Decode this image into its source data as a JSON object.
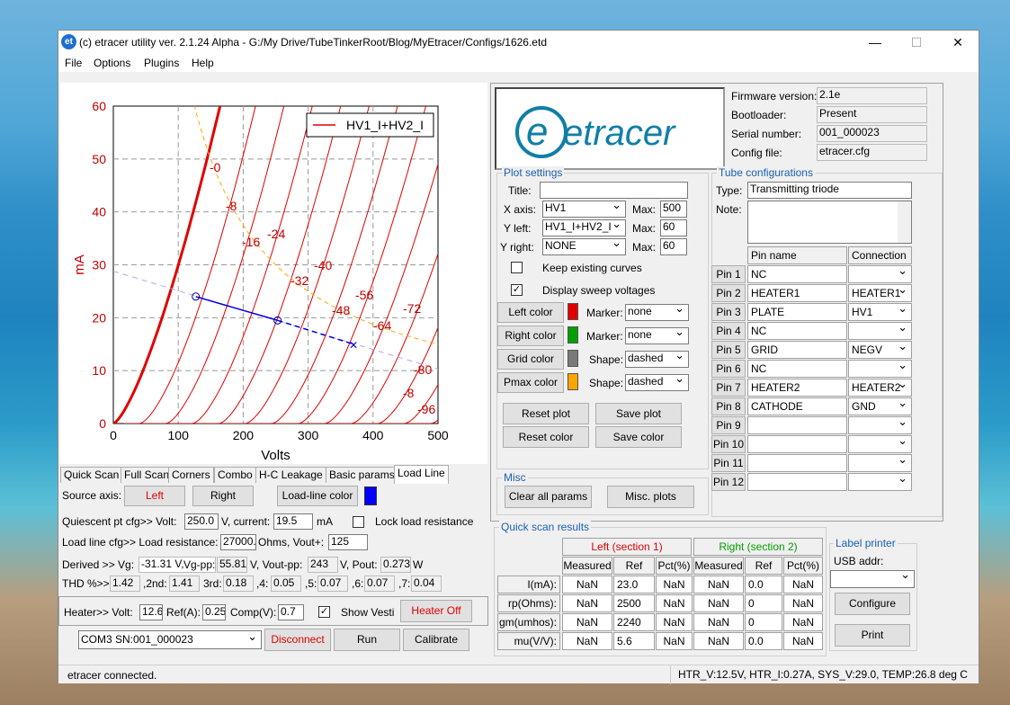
{
  "window": {
    "title": "(c) etracer utility ver. 2.1.24 Alpha - G:/My Drive/TubeTinkerRoot/Blog/MyEtracer/Configs/1626.etd",
    "logo": "et",
    "minimize": "—",
    "maximize": "☐",
    "close": "✕"
  },
  "menu": [
    "File",
    "Options",
    "Plugins",
    "Help"
  ],
  "chart_data": {
    "type": "line",
    "xlabel": "Volts",
    "ylabel": "mA",
    "xlim": [
      0,
      500
    ],
    "ylim": [
      0,
      60
    ],
    "xticks": [
      "0",
      "100",
      "200",
      "300",
      "400",
      "500"
    ],
    "yticks": [
      "0",
      "10",
      "20",
      "30",
      "40",
      "50",
      "60"
    ],
    "legend": "HV1_I+HV2_I",
    "curve_labels": [
      "-0",
      "-8",
      "-16",
      "-24",
      "-32",
      "-40",
      "-48",
      "-56",
      "-64",
      "-72",
      "-80",
      "-8",
      "-96"
    ],
    "grid": true,
    "load_line": {
      "points": [
        [
          127,
          24
        ],
        [
          253,
          19.5
        ],
        [
          370,
          15
        ]
      ]
    }
  },
  "tabs": [
    "Quick Scan",
    "Full Scan",
    "Corners",
    "Combo",
    "H-C Leakage",
    "Basic params",
    "Load Line"
  ],
  "loadline": {
    "source_axis_label": "Source axis:",
    "left": "Left",
    "right": "Right",
    "color_btn": "Load-line color",
    "line_color": "#0000ff",
    "qpt_label": "Quiescent pt cfg>>  Volt:",
    "qpt_volt": "250.0",
    "qpt_current_label": "V, current:",
    "qpt_current": "19.5",
    "qpt_unit": "mA",
    "lock_label": "Lock load resistance",
    "ll_cfg_label": "Load line cfg>>  Load resistance:",
    "load_res": "27000.0",
    "ohms_label": "Ohms, Vout+:",
    "vout": "125",
    "derived_label": "Derived >>  Vg:",
    "vg": "-31.31 V,",
    "vgpp_label": "Vg-pp:",
    "vgpp": "55.81",
    "vout_pp_label": "V, Vout-pp:",
    "vout_pp": "243",
    "pout_label": "V, Pout:",
    "pout": "0.2732",
    "w": "W",
    "thd_label": "THD %>>",
    "thd_total": "1.42",
    "h2_label": ",2nd:",
    "h2": "1.41",
    "h3_label": "3rd:",
    "h3": "0.18",
    "h4_label": ",4:",
    "h4": "0.05",
    "h5_label": ",5:",
    "h5": "0.07",
    "h6_label": ",6:",
    "h6": "0.07",
    "h7_label": ",7:",
    "h7": "0.04"
  },
  "heater": {
    "label": "Heater>>  Volt:",
    "volt": "12.6",
    "ref_label": "Ref(A):",
    "ref": "0.25",
    "comp_label": "Comp(V):",
    "comp": "0.7",
    "show_vesti": "Show Vesti",
    "off_btn": "Heater Off"
  },
  "bottom": {
    "port": "COM3 SN:001_000023",
    "disconnect": "Disconnect",
    "run": "Run",
    "calibrate": "Calibrate"
  },
  "info": {
    "brand": "etracer",
    "firmware_label": "Firmware version:",
    "firmware": "2.1e",
    "boot_label": "Bootloader:",
    "boot": "Present",
    "serial_label": "Serial number:",
    "serial": "001_000023",
    "config_label": "Config file:",
    "config": "etracer.cfg"
  },
  "plot": {
    "title": "Plot settings",
    "title_label": "Title:",
    "title_value": "",
    "xaxis_label": "X axis:",
    "xaxis": "HV1",
    "max_label": "Max:",
    "xmax": "500",
    "yleft_label": "Y left:",
    "yleft": "HV1_I+HV2_I",
    "ylmax": "60",
    "yright_label": "Y right:",
    "yright": "NONE",
    "yrmax": "60",
    "keep": "Keep existing curves",
    "display_sweep": "Display sweep voltages",
    "left_color": "Left color",
    "right_color": "Right color",
    "grid_color": "Grid color",
    "pmax_color": "Pmax color",
    "marker_label": "Marker:",
    "shape_label": "Shape:",
    "left_marker": "none",
    "right_marker": "none",
    "grid_shape": "dashed",
    "pmax_shape": "dashed",
    "left_swatch": "#e00000",
    "right_swatch": "#00a000",
    "grid_swatch": "#7a7a7a",
    "pmax_swatch": "#ffa500",
    "reset_plot": "Reset plot",
    "save_plot": "Save plot",
    "reset_color": "Reset color",
    "save_color": "Save color"
  },
  "misc": {
    "title": "Misc",
    "clear": "Clear all params",
    "plots": "Misc. plots"
  },
  "tube": {
    "title": "Tube configurations",
    "type_label": "Type:",
    "type": "Transmitting triode",
    "note_label": "Note:",
    "col_pin": "Pin name",
    "col_conn": "Connection",
    "pins": [
      {
        "btn": "Pin 1",
        "name": "NC",
        "conn": ""
      },
      {
        "btn": "Pin 2",
        "name": "HEATER1",
        "conn": "HEATER1"
      },
      {
        "btn": "Pin 3",
        "name": "PLATE",
        "conn": "HV1"
      },
      {
        "btn": "Pin 4",
        "name": "NC",
        "conn": ""
      },
      {
        "btn": "Pin 5",
        "name": "GRID",
        "conn": "NEGV"
      },
      {
        "btn": "Pin 6",
        "name": "NC",
        "conn": ""
      },
      {
        "btn": "Pin 7",
        "name": "HEATER2",
        "conn": "HEATER2"
      },
      {
        "btn": "Pin 8",
        "name": "CATHODE",
        "conn": "GND"
      },
      {
        "btn": "Pin 9",
        "name": "",
        "conn": ""
      },
      {
        "btn": "Pin 10",
        "name": "",
        "conn": ""
      },
      {
        "btn": "Pin 11",
        "name": "",
        "conn": ""
      },
      {
        "btn": "Pin 12",
        "name": "",
        "conn": ""
      }
    ]
  },
  "quick": {
    "title": "Quick scan results",
    "left_header": "Left (section 1)",
    "right_header": "Right (section 2)",
    "cols": [
      "Measured",
      "Ref",
      "Pct(%)",
      "Measured",
      "Ref",
      "Pct(%)"
    ],
    "rows": [
      {
        "label": "I(mA):",
        "v": [
          "NaN",
          "23.0",
          "NaN",
          "NaN",
          "0.0",
          "NaN"
        ]
      },
      {
        "label": "rp(Ohms):",
        "v": [
          "NaN",
          "2500",
          "NaN",
          "NaN",
          "0",
          "NaN"
        ]
      },
      {
        "label": "gm(umhos):",
        "v": [
          "NaN",
          "2240",
          "NaN",
          "NaN",
          "0",
          "NaN"
        ]
      },
      {
        "label": "mu(V/V):",
        "v": [
          "NaN",
          "5.6",
          "NaN",
          "NaN",
          "0.0",
          "NaN"
        ]
      }
    ]
  },
  "printer": {
    "title": "Label printer",
    "usb_label": "USB addr:",
    "usb": "",
    "configure": "Configure",
    "print": "Print"
  },
  "status": {
    "left": "etracer connected.",
    "right": "HTR_V:12.5V, HTR_I:0.27A, SYS_V:29.0, TEMP:26.8 deg C"
  }
}
